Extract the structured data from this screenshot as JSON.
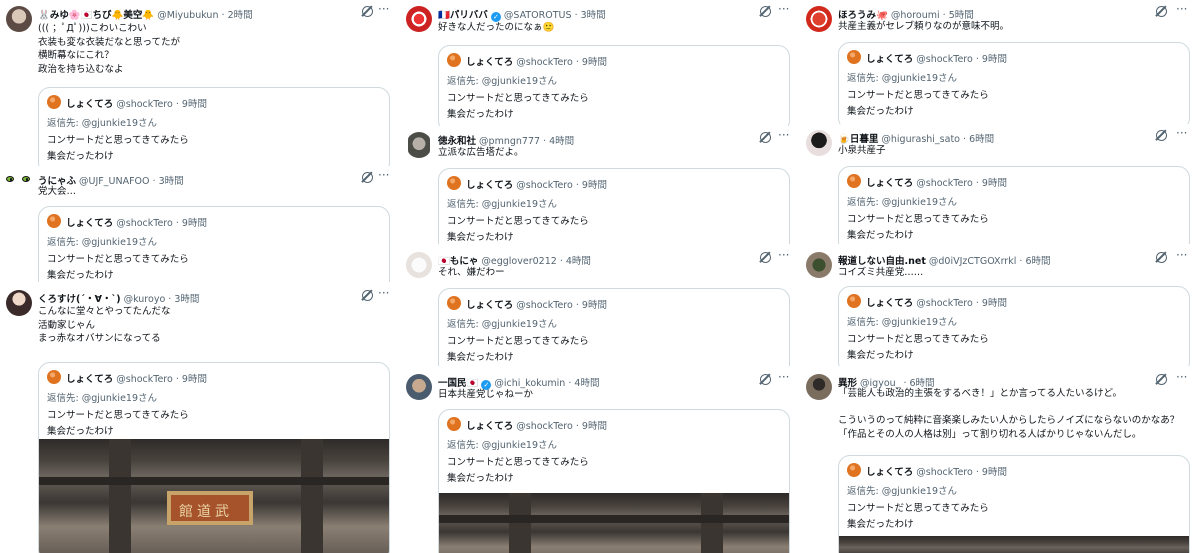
{
  "quoted": {
    "name": "しょくてろ",
    "handle": "@shockTero",
    "time": "9時間",
    "reply_to": "返信先: @gjunkie19さん",
    "line1": "コンサートだと思ってきてみたら",
    "line2": "集会だったわけ"
  },
  "photo_plaque": "館道武",
  "columns": [
    {
      "tweets": [
        {
          "name": "🐰みゆ🌸🇯🇵ちび🐥美空🐥",
          "handle": "@Miyubukun",
          "time": "2時間",
          "body": "((( ；ﾟДﾟ)))こわいこわい\n衣装も変な衣装だなと思ってたが\n横断幕なにこれ？\n政治を持ち込むなよ"
        },
        {
          "name": "うにゃふ",
          "handle": "@UJF_UNAFOO",
          "time": "3時間",
          "body": "党大会…"
        },
        {
          "name": "くろすけ(´・∀・`)",
          "handle": "@kuroyo",
          "time": "3時間",
          "body": "こんなに堂々とやってたんだな\n活動家じゃん\nまっ赤なオバサンになってる"
        }
      ]
    },
    {
      "tweets": [
        {
          "name": "🇫🇷パリババ",
          "handle": "@SATOROTUS",
          "time": "3時間",
          "body": "好きな人だったのになぁ🙂"
        },
        {
          "name": "徳永和社",
          "handle": "@pmngn777",
          "time": "4時間",
          "body": "立派な広告塔だよ。"
        },
        {
          "name": "🇯🇵もにゃ",
          "handle": "@egglover0212",
          "time": "4時間",
          "body": "それ、嫌だわー"
        },
        {
          "name": "一国民🇯🇵",
          "handle": "@ichi_kokumin",
          "time": "4時間",
          "body": "日本共産党じゃねーか"
        }
      ]
    },
    {
      "tweets": [
        {
          "name": "ほろうみ🐙",
          "handle": "@horoumi",
          "time": "5時間",
          "body": "共産主義がセレブ頼りなのが意味不明。"
        },
        {
          "name": "🍺日暮里",
          "handle": "@higurashi_sato",
          "time": "6時間",
          "body": "小泉共産子"
        },
        {
          "name": "報道しない自由.net",
          "handle": "@d0iVJzCTGOXrrkl",
          "time": "6時間",
          "body": "コイズミ共産党……"
        },
        {
          "name": "異形",
          "handle": "@igyou_",
          "time": "6時間",
          "body": "「芸能人も政治的主張をするべき！」とか言ってる人たいるけど。\n\nこういうのって純粋に音楽楽しみたい人からしたらノイズにならないのかなあ？\n「作品とその人の人格は別」って割り切れる人ばかりじゃないんだし。"
        }
      ]
    }
  ]
}
